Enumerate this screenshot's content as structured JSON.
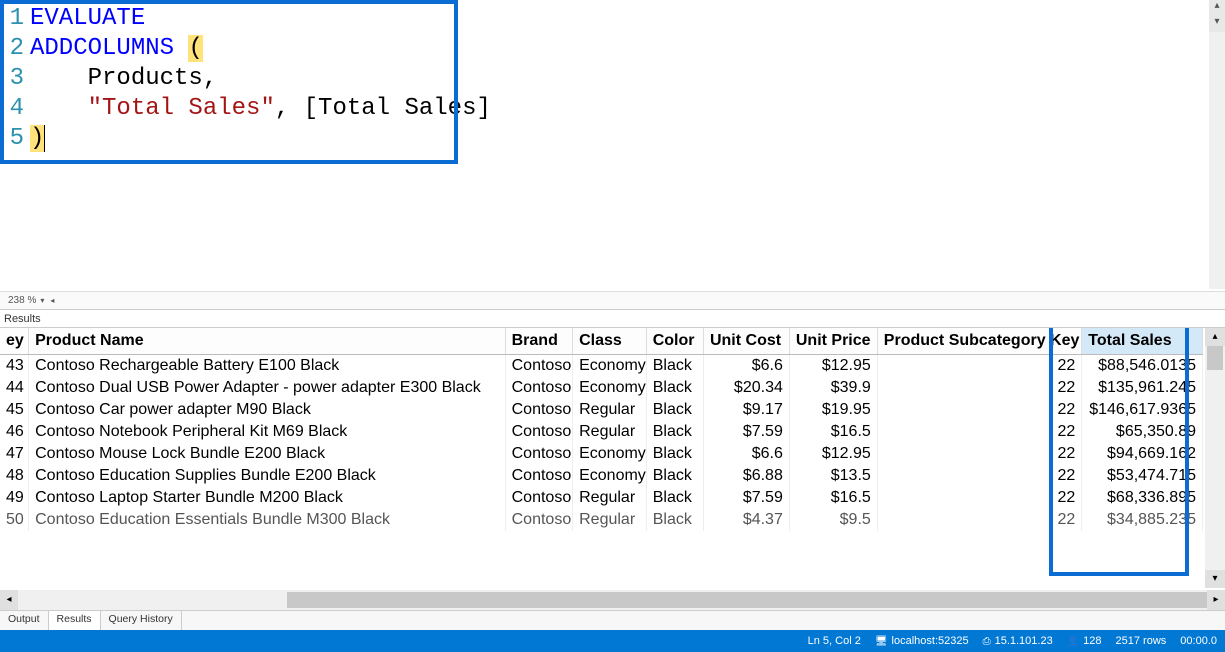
{
  "editor": {
    "zoom": "238 %",
    "lines": [
      {
        "n": "1",
        "tokens": [
          {
            "t": "EVALUATE",
            "c": "kw"
          }
        ]
      },
      {
        "n": "2",
        "tokens": [
          {
            "t": "ADDCOLUMNS",
            "c": "kw"
          },
          {
            "t": " ",
            "c": "plain"
          },
          {
            "t": "(",
            "c": "paren-hl"
          }
        ]
      },
      {
        "n": "3",
        "tokens": [
          {
            "t": "    Products",
            "c": "ident"
          },
          {
            "t": ",",
            "c": "plain"
          }
        ]
      },
      {
        "n": "4",
        "tokens": [
          {
            "t": "    ",
            "c": "plain"
          },
          {
            "t": "\"Total Sales\"",
            "c": "str"
          },
          {
            "t": ", [Total Sales]",
            "c": "plain"
          }
        ]
      },
      {
        "n": "5",
        "tokens": [
          {
            "t": ")",
            "c": "paren-cursor"
          }
        ]
      }
    ]
  },
  "results_label": "Results",
  "columns": [
    {
      "key": "key",
      "label": "ey",
      "cls": "col-key"
    },
    {
      "key": "name",
      "label": "Product Name",
      "cls": "col-name"
    },
    {
      "key": "brand",
      "label": "Brand",
      "cls": "col-brand"
    },
    {
      "key": "class",
      "label": "Class",
      "cls": "col-class"
    },
    {
      "key": "color",
      "label": "Color",
      "cls": "col-color"
    },
    {
      "key": "ucost",
      "label": "Unit Cost",
      "cls": "col-ucost",
      "num": true
    },
    {
      "key": "uprice",
      "label": "Unit Price",
      "cls": "col-uprice",
      "num": true
    },
    {
      "key": "subkey",
      "label": "Product Subcategory Key",
      "cls": "col-subkey",
      "num": true
    },
    {
      "key": "total",
      "label": "Total Sales",
      "cls": "col-total",
      "num": true,
      "sel": true
    }
  ],
  "rows": [
    {
      "key": "43",
      "name": "Contoso Rechargeable Battery E100 Black",
      "brand": "Contoso",
      "class": "Economy",
      "color": "Black",
      "ucost": "$6.6",
      "uprice": "$12.95",
      "subkey": "22",
      "total": "$88,546.0135"
    },
    {
      "key": "44",
      "name": "Contoso Dual USB Power Adapter - power adapter E300 Black",
      "brand": "Contoso",
      "class": "Economy",
      "color": "Black",
      "ucost": "$20.34",
      "uprice": "$39.9",
      "subkey": "22",
      "total": "$135,961.245"
    },
    {
      "key": "45",
      "name": "Contoso Car power adapter M90 Black",
      "brand": "Contoso",
      "class": "Regular",
      "color": "Black",
      "ucost": "$9.17",
      "uprice": "$19.95",
      "subkey": "22",
      "total": "$146,617.9365"
    },
    {
      "key": "46",
      "name": "Contoso Notebook Peripheral Kit M69 Black",
      "brand": "Contoso",
      "class": "Regular",
      "color": "Black",
      "ucost": "$7.59",
      "uprice": "$16.5",
      "subkey": "22",
      "total": "$65,350.89"
    },
    {
      "key": "47",
      "name": "Contoso Mouse Lock Bundle E200 Black",
      "brand": "Contoso",
      "class": "Economy",
      "color": "Black",
      "ucost": "$6.6",
      "uprice": "$12.95",
      "subkey": "22",
      "total": "$94,669.162"
    },
    {
      "key": "48",
      "name": "Contoso Education Supplies Bundle E200 Black",
      "brand": "Contoso",
      "class": "Economy",
      "color": "Black",
      "ucost": "$6.88",
      "uprice": "$13.5",
      "subkey": "22",
      "total": "$53,474.715"
    },
    {
      "key": "49",
      "name": "Contoso Laptop Starter Bundle M200 Black",
      "brand": "Contoso",
      "class": "Regular",
      "color": "Black",
      "ucost": "$7.59",
      "uprice": "$16.5",
      "subkey": "22",
      "total": "$68,336.895"
    },
    {
      "key": "50",
      "name": "Contoso Education Essentials Bundle M300 Black",
      "brand": "Contoso",
      "class": "Regular",
      "color": "Black",
      "ucost": "$4.37",
      "uprice": "$9.5",
      "subkey": "22",
      "total": "$34,885.235"
    }
  ],
  "tabs": [
    {
      "label": "Output",
      "active": false
    },
    {
      "label": "Results",
      "active": true
    },
    {
      "label": "Query History",
      "active": false
    }
  ],
  "status": {
    "cursor": "Ln 5, Col 2",
    "server": "localhost:52325",
    "version": "15.1.101.23",
    "users": "128",
    "rows": "2517 rows",
    "time": "00:00.0"
  }
}
